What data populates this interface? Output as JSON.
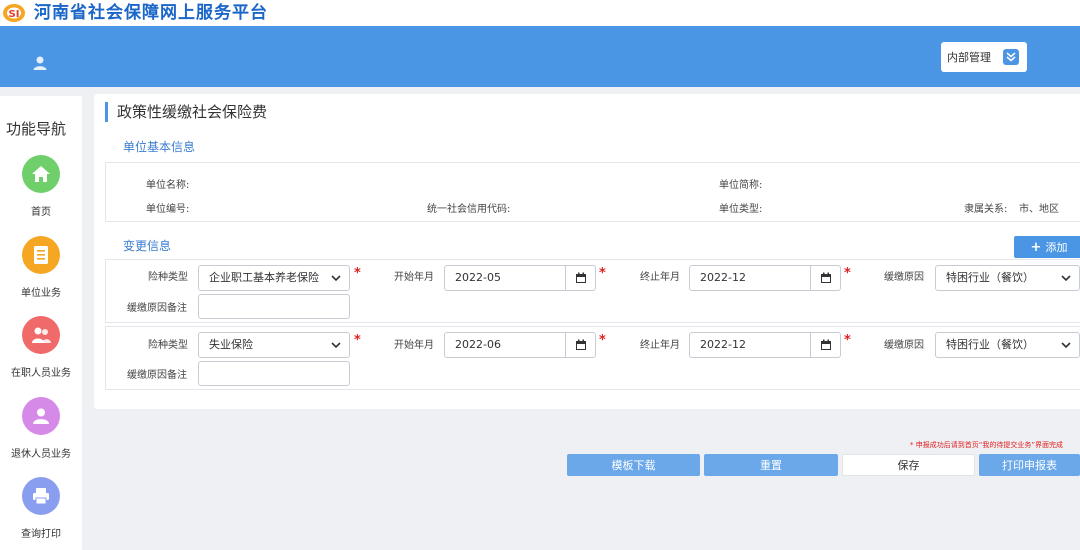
{
  "site": {
    "title": "河南省社会保障网上服务平台"
  },
  "header": {
    "admin_label": "内部管理"
  },
  "sidebar": {
    "title": "功能导航",
    "items": [
      {
        "label": "首页",
        "color": "#6fd06b",
        "icon": "home-icon"
      },
      {
        "label": "单位业务",
        "color": "#f5a623",
        "icon": "document-icon"
      },
      {
        "label": "在职人员业务",
        "color": "#f06a6a",
        "icon": "people-icon"
      },
      {
        "label": "退休人员业务",
        "color": "#d68ae8",
        "icon": "person-icon"
      },
      {
        "label": "查询打印",
        "color": "#8a9ef0",
        "icon": "printer-icon"
      }
    ]
  },
  "page": {
    "title": "政策性缓缴社会保险费"
  },
  "basic_info": {
    "section_title": "单位基本信息",
    "unit_name_label": "单位名称:",
    "unit_short_label": "单位简称:",
    "unit_no_label": "单位编号:",
    "credit_code_label": "统一社会信用代码:",
    "unit_type_label": "单位类型:",
    "affiliation_label": "隶属关系:",
    "affiliation_value": "市、地区"
  },
  "change_info": {
    "section_title": "变更信息",
    "add_label": "添加",
    "rows": [
      {
        "insurance_type_label": "险种类型",
        "insurance_type_value": "企业职工基本养老保险",
        "start_label": "开始年月",
        "start_value": "2022-05",
        "end_label": "终止年月",
        "end_value": "2022-12",
        "reason_label": "缓缴原因",
        "reason_value": "特困行业（餐饮）",
        "remark_label": "缓缴原因备注"
      },
      {
        "insurance_type_label": "险种类型",
        "insurance_type_value": "失业保险",
        "start_label": "开始年月",
        "start_value": "2022-06",
        "end_label": "终止年月",
        "end_value": "2022-12",
        "reason_label": "缓缴原因",
        "reason_value": "特困行业（餐饮）",
        "remark_label": "缓缴原因备注"
      }
    ]
  },
  "footer": {
    "notice": "* 申报成功后请到首页“我的待提交业务”界面完成",
    "template_download": "模板下载",
    "reset": "重置",
    "save": "保存",
    "print": "打印申报表"
  },
  "colors": {
    "header": "#4a96e4",
    "accent": "#3a7dd0",
    "required": "#e02020"
  }
}
